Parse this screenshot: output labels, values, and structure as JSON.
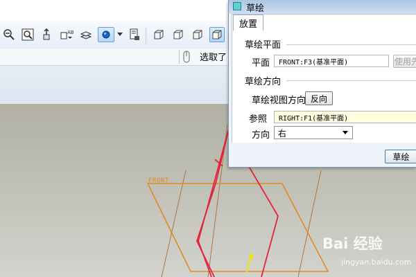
{
  "toolbar": {
    "icons": [
      "zoom-out-icon",
      "zoom-window-icon",
      "reorient-icon",
      "annotation-display-icon",
      "layer-icon",
      "spin-center-icon",
      "dropdown-arrow-icon",
      "view-manager-icon",
      "no-hidden-icon",
      "hidden-line-icon",
      "wireframe-icon",
      "shading-icon"
    ]
  },
  "status": {
    "selection_text": "选取了"
  },
  "viewport": {
    "datum_label": "FRONT",
    "colors": {
      "background_top": "#b1b0a3",
      "datum": "#e08a20",
      "sketch_outline": "#e0243a",
      "thin_line": "#a77746",
      "axis_arrow": "#f5e300"
    }
  },
  "dialog": {
    "title": "草绘",
    "tab_label": "放置",
    "sketch_plane": {
      "section_label": "草绘平面",
      "plane_label": "平面",
      "plane_value": "FRONT:F3(基准平面)",
      "use_previous_label": "使用先"
    },
    "orientation": {
      "section_label": "草绘方向",
      "view_direction_label": "草绘视图方向",
      "flip_button_label": "反向",
      "reference_label": "参照",
      "reference_value": "RIGHT:F1(基准平面)",
      "direction_label": "方向",
      "direction_value": "右"
    },
    "sketch_button_label": "草绘"
  },
  "watermark": {
    "logo_text": "Bai 经验",
    "url": "jingyan.baidu.com"
  }
}
